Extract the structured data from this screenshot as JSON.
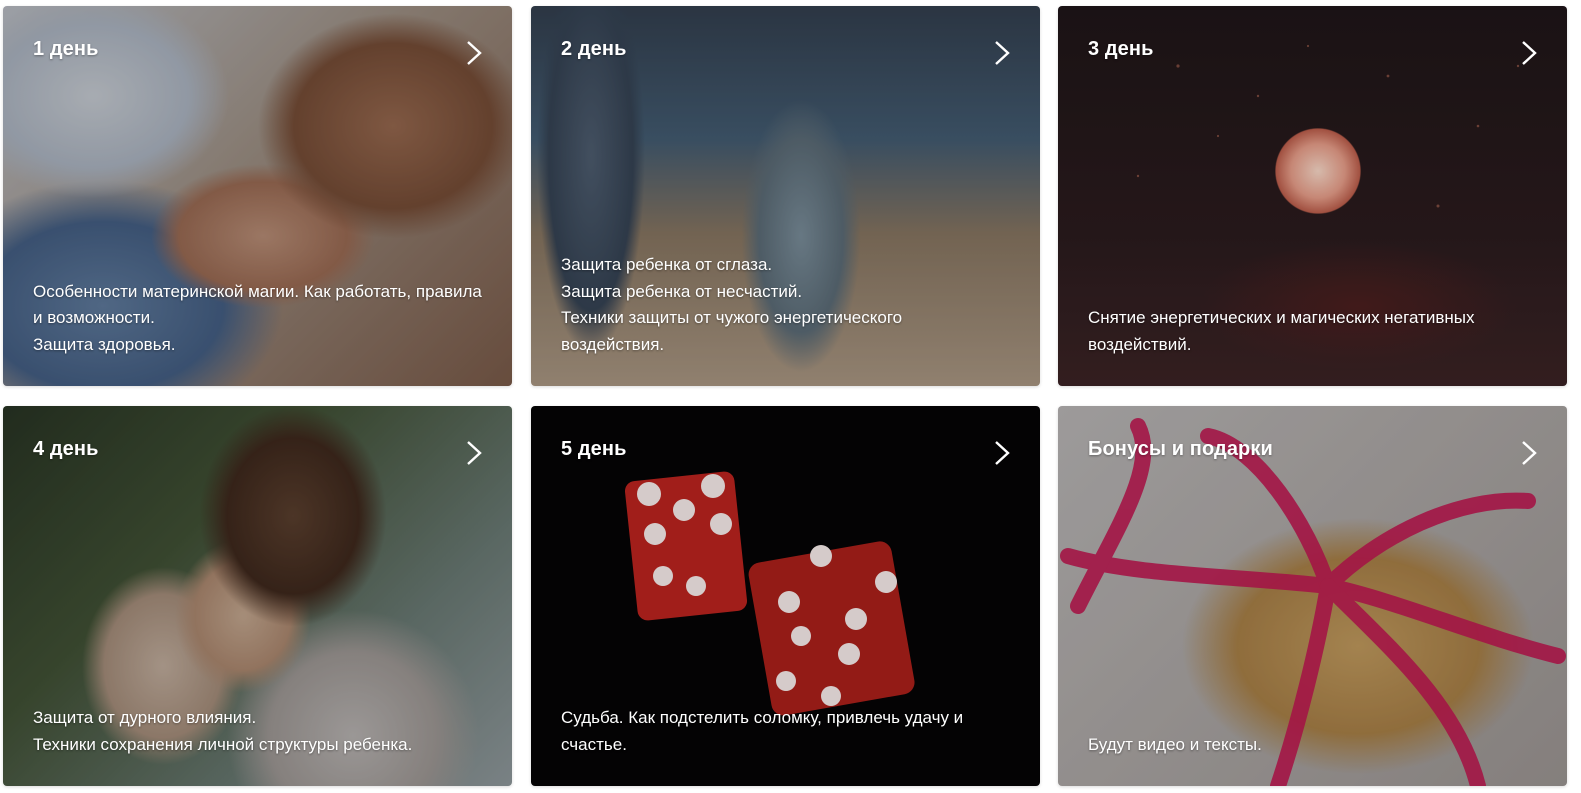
{
  "cards": [
    {
      "title": "1 день",
      "lines": [
        "Особенности материнской магии. Как работать, правила",
        "и возможности.",
        "Защита здоровья."
      ]
    },
    {
      "title": "2 день",
      "lines": [
        "Защита ребенка от сглаза.",
        "Защита ребенка от несчастий.",
        "Техники защиты от чужого энергетического",
        "воздействия."
      ]
    },
    {
      "title": "3 день",
      "lines": [
        "Снятие энергетических и магических негативных",
        "воздействий."
      ]
    },
    {
      "title": "4 день",
      "lines": [
        "Защита от дурного влияния.",
        "Техники сохранения личной структуры ребенка."
      ]
    },
    {
      "title": "5 день",
      "lines": [
        "Судьба. Как подстелить соломку, привлечь удачу и",
        "счастье."
      ]
    },
    {
      "title": "Бонусы и подарки",
      "lines": [
        "Будут видео и тексты."
      ]
    }
  ],
  "icons": {
    "arrow": "chevron-right-icon"
  },
  "colors": {
    "text": "#ffffff",
    "page_background": "#ffffff"
  }
}
